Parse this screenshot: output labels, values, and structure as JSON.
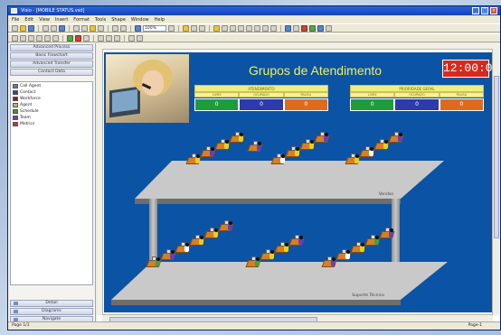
{
  "window": {
    "title": "Visio - [MOBILE STATUS.vsd]"
  },
  "menu": [
    "File",
    "Edit",
    "View",
    "Insert",
    "Format",
    "Tools",
    "Shape",
    "Window",
    "Help"
  ],
  "toolbar": {
    "zoom": "100%"
  },
  "shapes_panel": {
    "stencils": [
      "Advanced Process",
      "Basic Flowchart",
      "Advanced Transfer",
      "Contact Data"
    ],
    "shapes": [
      {
        "label": "Call Agent",
        "color": "#7a7a7a"
      },
      {
        "label": "Contact",
        "color": "#3b3bb0"
      },
      {
        "label": "Workforce",
        "color": "#8b1f1f"
      },
      {
        "label": "Agent",
        "color": "#c9b36b"
      },
      {
        "label": "Schedule",
        "color": "#4a8a3c"
      },
      {
        "label": "Team",
        "color": "#7b3d99"
      },
      {
        "label": "Metrics",
        "color": "#c0392b"
      }
    ],
    "bottom_sections": [
      "Detail",
      "Diagrams",
      "Navigate"
    ]
  },
  "drawing": {
    "title": "Grupos de Atendimento",
    "clock": "12:00:00",
    "panels": [
      {
        "header": "ATENDIMENTO",
        "columns": [
          "LIVRE",
          "OCUPADO",
          "PAUSA"
        ],
        "values": [
          "0",
          "0",
          "0"
        ]
      },
      {
        "header": "PRIORIDADE GERAL",
        "columns": [
          "LIVRE",
          "OCUPADO",
          "PAUSA"
        ],
        "values": [
          "0",
          "0",
          "0"
        ]
      }
    ],
    "floor_labels": [
      "Vendas",
      "Suporte Técnico"
    ]
  },
  "status": {
    "left": "Page 1/1",
    "right": "Page-1"
  },
  "colors": {
    "canvas_bg": "#0b53a4",
    "title": "#f2f05a",
    "clock_bg": "#d62a1e",
    "green": "#1f9c3a",
    "blue": "#2d3aa8",
    "orange": "#e06a1c"
  }
}
